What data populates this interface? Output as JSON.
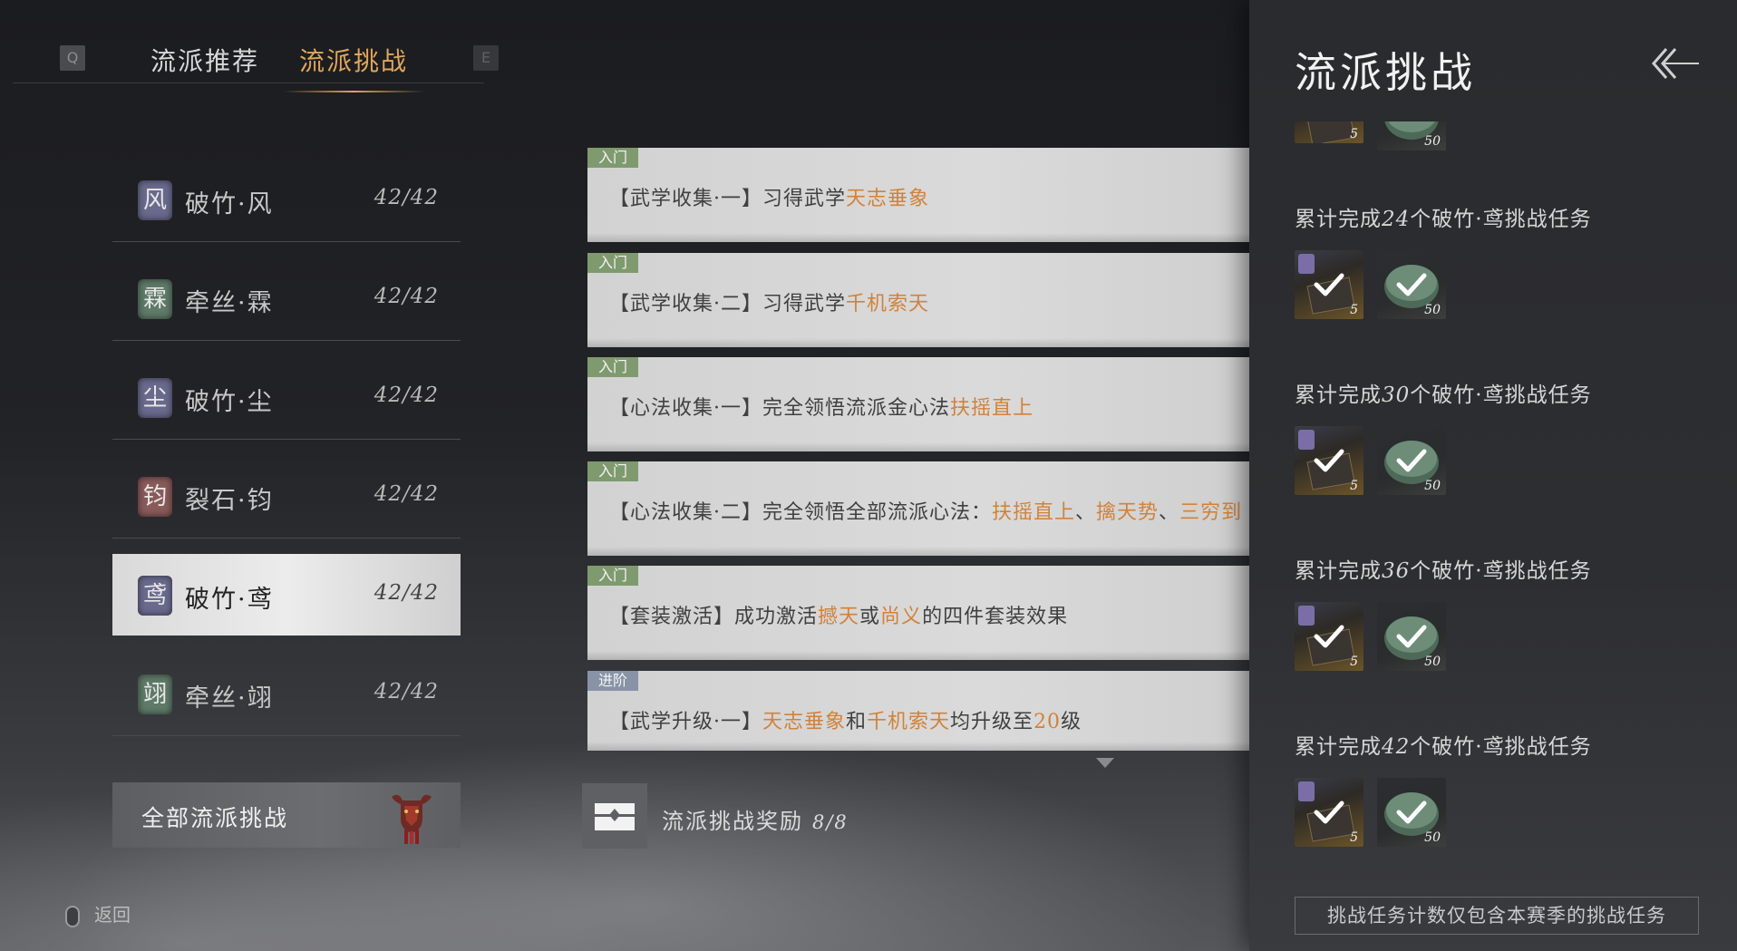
{
  "tabs": {
    "left_key": "Q",
    "right_key": "E",
    "items": [
      {
        "label": "流派推荐",
        "active": false
      },
      {
        "label": "流派挑战",
        "active": true
      }
    ]
  },
  "schools": [
    {
      "seal": "风",
      "name": "破竹·风",
      "count": "42/42",
      "seal_color": "#6a6a8e",
      "selected": false
    },
    {
      "seal": "霖",
      "name": "牵丝·霖",
      "count": "42/42",
      "seal_color": "#5f7a68",
      "selected": false
    },
    {
      "seal": "尘",
      "name": "破竹·尘",
      "count": "42/42",
      "seal_color": "#6a6a8e",
      "selected": false
    },
    {
      "seal": "钧",
      "name": "裂石·钧",
      "count": "42/42",
      "seal_color": "#8a5a5a",
      "selected": false
    },
    {
      "seal": "鸢",
      "name": "破竹·鸢",
      "count": "42/42",
      "seal_color": "#6a6a8e",
      "selected": true
    },
    {
      "seal": "翊",
      "name": "牵丝·翊",
      "count": "42/42",
      "seal_color": "#5f7a68",
      "selected": false
    }
  ],
  "all_challenges_label": "全部流派挑战",
  "back_label": "返回",
  "tasks": [
    {
      "tag": "入门",
      "tag_color": "green",
      "parts": [
        {
          "t": "【武学收集·一】习得武学"
        },
        {
          "t": "天志垂象",
          "hl": true
        }
      ]
    },
    {
      "tag": "入门",
      "tag_color": "green",
      "parts": [
        {
          "t": "【武学收集·二】习得武学"
        },
        {
          "t": "千机索天",
          "hl": true
        }
      ]
    },
    {
      "tag": "入门",
      "tag_color": "green",
      "parts": [
        {
          "t": "【心法收集·一】完全领悟流派金心法"
        },
        {
          "t": "扶摇直上",
          "hl": true
        }
      ]
    },
    {
      "tag": "入门",
      "tag_color": "green",
      "parts": [
        {
          "t": "【心法收集·二】完全领悟全部流派心法："
        },
        {
          "t": "扶摇直上",
          "hl": true
        },
        {
          "t": "、"
        },
        {
          "t": "擒天势",
          "hl": true
        },
        {
          "t": "、"
        },
        {
          "t": "三穷到",
          "hl": true
        }
      ]
    },
    {
      "tag": "入门",
      "tag_color": "green",
      "parts": [
        {
          "t": "【套装激活】成功激活"
        },
        {
          "t": "撼天",
          "hl": true
        },
        {
          "t": "或"
        },
        {
          "t": "尚义",
          "hl": true
        },
        {
          "t": "的四件套装效果"
        }
      ]
    },
    {
      "tag": "进阶",
      "tag_color": "blue",
      "parts": [
        {
          "t": "【武学升级·一】"
        },
        {
          "t": "天志垂象",
          "hl": true
        },
        {
          "t": "和"
        },
        {
          "t": "千机索天",
          "hl": true
        },
        {
          "t": "均升级至"
        },
        {
          "t": "20",
          "hl": true
        },
        {
          "t": "级"
        }
      ]
    }
  ],
  "reward_bar": {
    "label": "流派挑战奖励",
    "progress": "8/8"
  },
  "panel": {
    "title": "流派挑战",
    "top_partial": {
      "book_qty": "5",
      "jade_qty": "50"
    },
    "goals": [
      {
        "prefix": "累计完成",
        "num": "24",
        "suffix": "个破竹·鸢挑战任务",
        "book_qty": "5",
        "jade_qty": "50",
        "claimed": true
      },
      {
        "prefix": "累计完成",
        "num": "30",
        "suffix": "个破竹·鸢挑战任务",
        "book_qty": "5",
        "jade_qty": "50",
        "claimed": true
      },
      {
        "prefix": "累计完成",
        "num": "36",
        "suffix": "个破竹·鸢挑战任务",
        "book_qty": "5",
        "jade_qty": "50",
        "claimed": true
      },
      {
        "prefix": "累计完成",
        "num": "42",
        "suffix": "个破竹·鸢挑战任务",
        "book_qty": "5",
        "jade_qty": "50",
        "claimed": true
      }
    ],
    "note": "挑战任务计数仅包含本赛季的挑战任务"
  },
  "colors": {
    "highlight": "#d1823a",
    "active_tab": "#e0a65a",
    "tag_green": "#7f9a6f",
    "tag_blue": "#8893a6"
  }
}
